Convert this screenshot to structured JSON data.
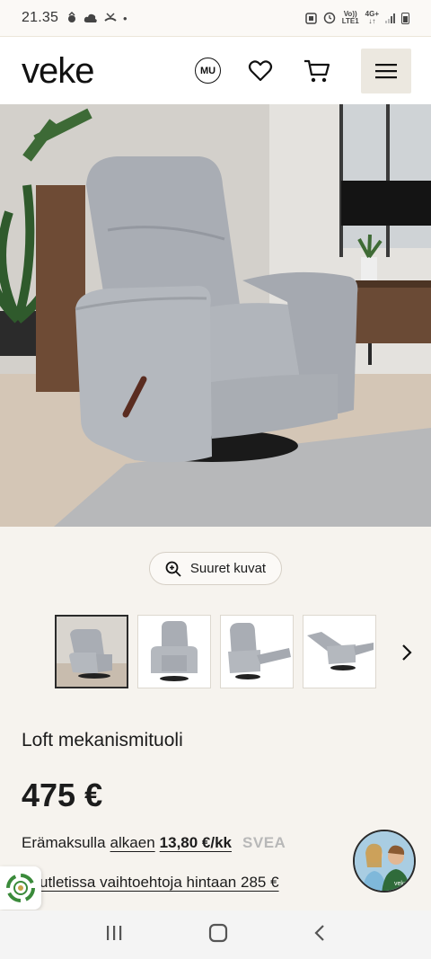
{
  "status_bar": {
    "time": "21.35",
    "network_top": "Vo))",
    "network_label": "LTE1",
    "network_type": "4G+",
    "dot": "•"
  },
  "header": {
    "logo": "veke",
    "account_label": "MU",
    "icons": [
      "heart-icon",
      "cart-icon",
      "menu-icon"
    ]
  },
  "gallery": {
    "large_images_label": "Suuret kuvat",
    "thumb_count": 4,
    "active_thumb": 0
  },
  "product": {
    "title": "Loft mekanismituoli",
    "price": "475 €",
    "installment_prefix": "Erämaksulla",
    "installment_link": "alkaen",
    "installment_amount": "13,80 €/kk",
    "installment_provider": "SVEA",
    "outlet_text": "utletissa vaihtoehtoja hintaan 285 €"
  },
  "colors": {
    "background": "#f6f3ee",
    "header_bg": "#ffffff",
    "menu_button_bg": "#ece8e0",
    "text": "#1c1c1c"
  }
}
